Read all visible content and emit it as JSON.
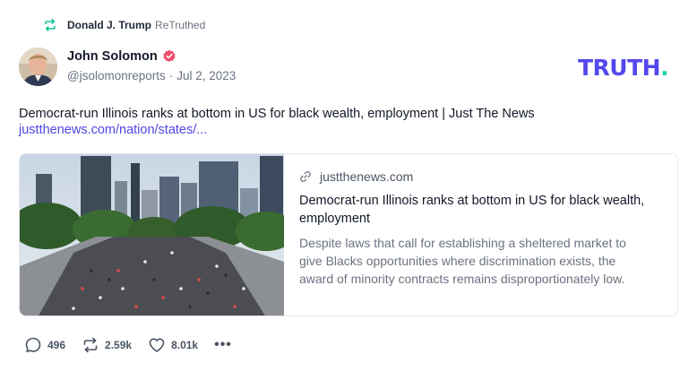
{
  "retruth": {
    "icon": "retruth-icon",
    "name": "Donald J. Trump",
    "label": "ReTruthed"
  },
  "author": {
    "avatar_icon": "avatar-photo",
    "name": "John Solomon",
    "verified_icon": "verified-badge-icon",
    "handle": "@jsolomonreports",
    "separator": "·",
    "date": "Jul 2, 2023"
  },
  "logo": {
    "text": "TRUTH",
    "dot": ".",
    "colors": {
      "text": "#5448ee",
      "dot": "#19d4a8"
    }
  },
  "post": {
    "text": "Democrat-run Illinois ranks at bottom in US for black wealth, employment  | Just The News",
    "link": "justthenews.com/nation/states/..."
  },
  "card": {
    "image_icon": "city-protest-photo",
    "link_icon": "link-icon",
    "domain": "justthenews.com",
    "title": "Democrat-run Illinois ranks at bottom in US for black wealth, employment",
    "description": "Despite laws that call for establishing a sheltered market to give Blacks opportunities where discrimination exists, the award of minority contracts remains disproportionately low."
  },
  "actions": {
    "replies": {
      "icon": "reply-icon",
      "count": "496"
    },
    "retruths": {
      "icon": "retruth-icon",
      "count": "2.59k"
    },
    "likes": {
      "icon": "heart-icon",
      "count": "8.01k"
    },
    "more": {
      "icon": "more-icon",
      "label": "•••"
    }
  }
}
